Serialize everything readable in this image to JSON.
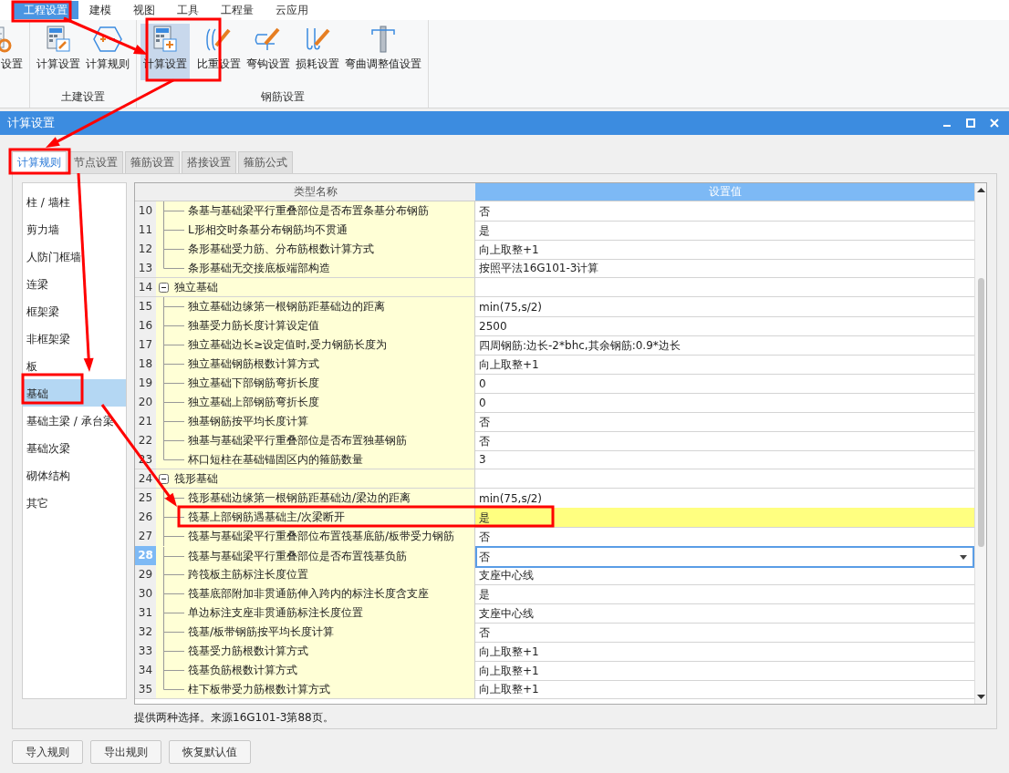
{
  "menu": [
    {
      "label": "工程设置",
      "selected": true
    },
    {
      "label": "建模",
      "selected": false
    },
    {
      "label": "视图",
      "selected": false
    },
    {
      "label": "工具",
      "selected": false
    },
    {
      "label": "工程量",
      "selected": false
    },
    {
      "label": "云应用",
      "selected": false
    }
  ],
  "ribbon": [
    {
      "buttons": [
        {
          "label": "设置",
          "selected": false
        }
      ]
    },
    {
      "label": "土建设置",
      "buttons": [
        {
          "label": "计算设置",
          "selected": false
        },
        {
          "label": "计算规则",
          "selected": false
        }
      ]
    },
    {
      "label": "钢筋设置",
      "buttons": [
        {
          "label": "计算设置",
          "selected": true
        },
        {
          "label": "比重设置",
          "selected": false
        },
        {
          "label": "弯钩设置",
          "selected": false
        },
        {
          "label": "损耗设置",
          "selected": false
        },
        {
          "label": "弯曲调整值设置",
          "selected": false
        }
      ]
    }
  ],
  "dialog": {
    "title": "计算设置",
    "tabs": [
      {
        "label": "计算规则",
        "selected": true
      },
      {
        "label": "节点设置",
        "selected": false
      },
      {
        "label": "箍筋设置",
        "selected": false
      },
      {
        "label": "搭接设置",
        "selected": false
      },
      {
        "label": "箍筋公式",
        "selected": false
      }
    ],
    "categories": [
      {
        "label": "柱 / 墙柱",
        "selected": false
      },
      {
        "label": "剪力墙",
        "selected": false
      },
      {
        "label": "人防门框墙",
        "selected": false
      },
      {
        "label": "连梁",
        "selected": false
      },
      {
        "label": "框架梁",
        "selected": false
      },
      {
        "label": "非框架梁",
        "selected": false
      },
      {
        "label": "板",
        "selected": false
      },
      {
        "label": "基础",
        "selected": true
      },
      {
        "label": "基础主梁 / 承台梁",
        "selected": false
      },
      {
        "label": "基础次梁",
        "selected": false
      },
      {
        "label": "砌体结构",
        "selected": false
      },
      {
        "label": "其它",
        "selected": false
      }
    ],
    "table": {
      "columns": [
        "类型名称",
        "设置值"
      ],
      "rows": [
        {
          "num": "10",
          "kind": "item",
          "name": "条基与基础梁平行重叠部位是否布置条基分布钢筋",
          "value": "否",
          "selected": false,
          "highlighted": false
        },
        {
          "num": "11",
          "kind": "item",
          "name": "L形相交时条基分布钢筋均不贯通",
          "value": "是",
          "selected": false,
          "highlighted": false
        },
        {
          "num": "12",
          "kind": "item",
          "name": "条形基础受力筋、分布筋根数计算方式",
          "value": "向上取整+1",
          "selected": false,
          "highlighted": false
        },
        {
          "num": "13",
          "kind": "item",
          "name": "条形基础无交接底板端部构造",
          "value": "按照平法16G101-3计算",
          "selected": false,
          "highlighted": false
        },
        {
          "num": "14",
          "kind": "group",
          "name": "独立基础",
          "expanded": true,
          "selected": false
        },
        {
          "num": "15",
          "kind": "item",
          "name": "独立基础边缘第一根钢筋距基础边的距离",
          "value": "min(75,s/2)",
          "selected": false,
          "highlighted": false
        },
        {
          "num": "16",
          "kind": "item",
          "name": "独基受力筋长度计算设定值",
          "value": "2500",
          "selected": false,
          "highlighted": false
        },
        {
          "num": "17",
          "kind": "item",
          "name": "独立基础边长≥设定值时,受力钢筋长度为",
          "value": "四周钢筋:边长-2*bhc,其余钢筋:0.9*边长",
          "selected": false,
          "highlighted": false
        },
        {
          "num": "18",
          "kind": "item",
          "name": "独立基础钢筋根数计算方式",
          "value": "向上取整+1",
          "selected": false,
          "highlighted": false
        },
        {
          "num": "19",
          "kind": "item",
          "name": "独立基础下部钢筋弯折长度",
          "value": "0",
          "selected": false,
          "highlighted": false
        },
        {
          "num": "20",
          "kind": "item",
          "name": "独立基础上部钢筋弯折长度",
          "value": "0",
          "selected": false,
          "highlighted": false
        },
        {
          "num": "21",
          "kind": "item",
          "name": "独基钢筋按平均长度计算",
          "value": "否",
          "selected": false,
          "highlighted": false
        },
        {
          "num": "22",
          "kind": "item",
          "name": "独基与基础梁平行重叠部位是否布置独基钢筋",
          "value": "否",
          "selected": false,
          "highlighted": false
        },
        {
          "num": "23",
          "kind": "item",
          "name": "杯口短柱在基础锚固区内的箍筋数量",
          "value": "3",
          "selected": false,
          "highlighted": false
        },
        {
          "num": "24",
          "kind": "group",
          "name": "筏形基础",
          "expanded": true,
          "selected": false
        },
        {
          "num": "25",
          "kind": "item",
          "name": "筏形基础边缘第一根钢筋距基础边/梁边的距离",
          "value": "min(75,s/2)",
          "selected": false,
          "highlighted": false
        },
        {
          "num": "26",
          "kind": "item",
          "name": "筏基上部钢筋遇基础主/次梁断开",
          "value": "是",
          "selected": false,
          "highlighted": true
        },
        {
          "num": "27",
          "kind": "item",
          "name": "筏基与基础梁平行重叠部位布置筏基底筋/板带受力钢筋",
          "value": "否",
          "selected": false,
          "highlighted": false
        },
        {
          "num": "28",
          "kind": "item",
          "name": "筏基与基础梁平行重叠部位是否布置筏基负筋",
          "value": "否",
          "selected": true,
          "highlighted": false
        },
        {
          "num": "29",
          "kind": "item",
          "name": "跨筏板主筋标注长度位置",
          "value": "支座中心线",
          "selected": false,
          "highlighted": false
        },
        {
          "num": "30",
          "kind": "item",
          "name": "筏基底部附加非贯通筋伸入跨内的标注长度含支座",
          "value": "是",
          "selected": false,
          "highlighted": false
        },
        {
          "num": "31",
          "kind": "item",
          "name": "单边标注支座非贯通筋标注长度位置",
          "value": "支座中心线",
          "selected": false,
          "highlighted": false
        },
        {
          "num": "32",
          "kind": "item",
          "name": "筏基/板带钢筋按平均长度计算",
          "value": "否",
          "selected": false,
          "highlighted": false
        },
        {
          "num": "33",
          "kind": "item",
          "name": "筏基受力筋根数计算方式",
          "value": "向上取整+1",
          "selected": false,
          "highlighted": false
        },
        {
          "num": "34",
          "kind": "item",
          "name": "筏基负筋根数计算方式",
          "value": "向上取整+1",
          "selected": false,
          "highlighted": false
        },
        {
          "num": "35",
          "kind": "item",
          "name": "柱下板带受力筋根数计算方式",
          "value": "向上取整+1",
          "selected": false,
          "highlighted": false
        }
      ]
    },
    "description": "提供两种选择。来源16G101-3第88页。",
    "buttons": [
      "导入规则",
      "导出规则",
      "恢复默认值"
    ]
  }
}
